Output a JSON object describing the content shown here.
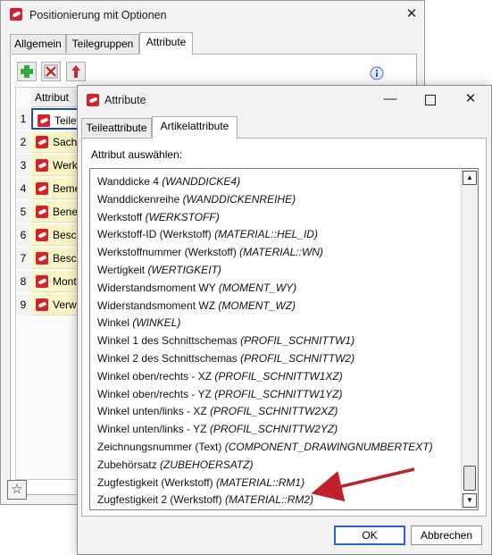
{
  "back_window": {
    "title": "Positionierung mit Optionen",
    "tabs": [
      "Allgemein",
      "Teilegruppen",
      "Attribute"
    ],
    "grid_header": "Attribut",
    "rows": [
      {
        "num": "1",
        "label": "Teile"
      },
      {
        "num": "2",
        "label": "Sach"
      },
      {
        "num": "3",
        "label": "Werk"
      },
      {
        "num": "4",
        "label": "Beme"
      },
      {
        "num": "5",
        "label": "Bene"
      },
      {
        "num": "6",
        "label": "Besch"
      },
      {
        "num": "7",
        "label": "Besch"
      },
      {
        "num": "8",
        "label": "Mont"
      },
      {
        "num": "9",
        "label": "Verw"
      }
    ],
    "icons": {
      "add": "add-icon",
      "delete": "delete-icon",
      "move_up": "move-up-icon",
      "info": "info-icon",
      "favorite": "star-icon"
    }
  },
  "dialog": {
    "title": "Attribute",
    "tabs": [
      "Teileattribute",
      "Artikelattribute"
    ],
    "prompt": "Attribut auswählen:",
    "items": [
      {
        "name": "Wanddicke 4",
        "code": "(WANDDICKE4)"
      },
      {
        "name": "Wanddickenreihe",
        "code": "(WANDDICKENREIHE)"
      },
      {
        "name": "Werkstoff",
        "code": "(WERKSTOFF)"
      },
      {
        "name": "Werkstoff-ID (Werkstoff)",
        "code": "(MATERIAL::HEL_ID)"
      },
      {
        "name": "Werkstoffnummer (Werkstoff)",
        "code": "(MATERIAL::WN)"
      },
      {
        "name": "Wertigkeit",
        "code": "(WERTIGKEIT)"
      },
      {
        "name": "Widerstandsmoment WY",
        "code": "(MOMENT_WY)"
      },
      {
        "name": "Widerstandsmoment WZ",
        "code": "(MOMENT_WZ)"
      },
      {
        "name": "Winkel",
        "code": "(WINKEL)"
      },
      {
        "name": "Winkel 1 des Schnittschemas",
        "code": "(PROFIL_SCHNITTW1)"
      },
      {
        "name": "Winkel 2 des Schnittschemas",
        "code": "(PROFIL_SCHNITTW2)"
      },
      {
        "name": "Winkel oben/rechts - XZ",
        "code": "(PROFIL_SCHNITTW1XZ)"
      },
      {
        "name": "Winkel oben/rechts - YZ",
        "code": "(PROFIL_SCHNITTW1YZ)"
      },
      {
        "name": "Winkel unten/links - XZ",
        "code": "(PROFIL_SCHNITTW2XZ)"
      },
      {
        "name": "Winkel unten/links - YZ",
        "code": "(PROFIL_SCHNITTW2YZ)"
      },
      {
        "name": "Zeichnungsnummer (Text)",
        "code": "(COMPONENT_DRAWINGNUMBERTEXT)"
      },
      {
        "name": "Zubehörsatz",
        "code": "(ZUBEHOERSATZ)"
      },
      {
        "name": "Zugfestigkeit (Werkstoff)",
        "code": "(MATERIAL::RM1)"
      },
      {
        "name": "Zugfestigkeit 2 (Werkstoff)",
        "code": "(MATERIAL::RM2)"
      }
    ],
    "ok_label": "OK",
    "cancel_label": "Abbrechen",
    "annotation_color": "#c0202a"
  }
}
